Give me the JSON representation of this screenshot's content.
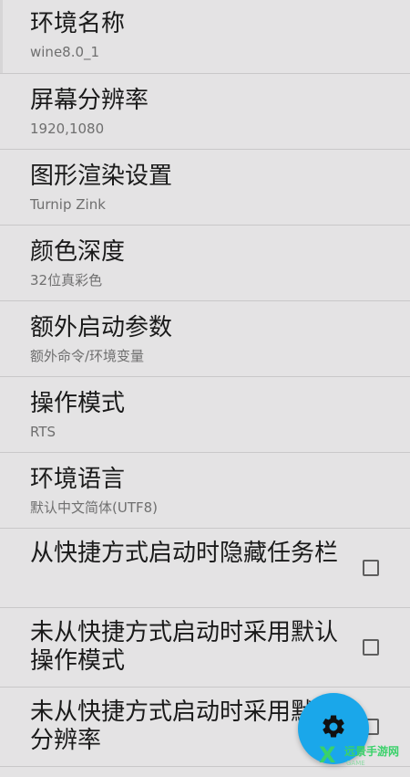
{
  "settings": {
    "items": [
      {
        "title": "环境名称",
        "subtitle": "wine8.0_1"
      },
      {
        "title": "屏幕分辨率",
        "subtitle": "1920,1080"
      },
      {
        "title": "图形渲染设置",
        "subtitle": "Turnip Zink"
      },
      {
        "title": "颜色深度",
        "subtitle": "32位真彩色"
      },
      {
        "title": "额外启动参数",
        "subtitle": "额外命令/环境变量"
      },
      {
        "title": "操作模式",
        "subtitle": "RTS"
      },
      {
        "title": "环境语言",
        "subtitle": "默认中文简体(UTF8)"
      }
    ],
    "checkbox_items": [
      {
        "title": "从快捷方式启动时隐藏任务栏",
        "checked": false
      },
      {
        "title": "未从快捷方式启动时采用默认操作模式",
        "checked": false
      },
      {
        "title": "未从快捷方式启动时采用默认分辨率",
        "checked": false
      }
    ]
  },
  "fab": {
    "icon": "gear-icon",
    "color": "#1aa7ea"
  },
  "watermark": {
    "text": "远景手游网",
    "sub": "GAME"
  }
}
